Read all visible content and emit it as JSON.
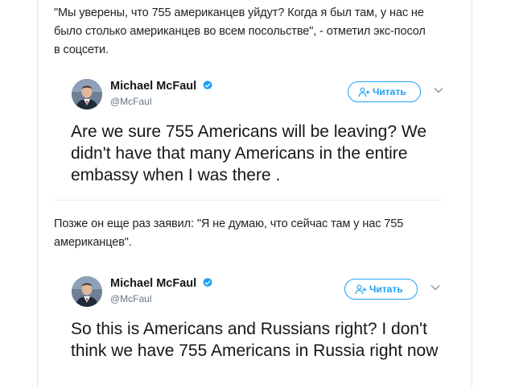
{
  "article": {
    "paragraph1": "\"Мы уверены, что 755 американцев уйдут? Когда я был там, у нас не было столько американцев во всем посольстве\", - отметил экс-посол в соцсети.",
    "paragraph2": "Позже он еще раз заявил: \"Я не думаю, что сейчас там у нас 755 американцев\"."
  },
  "tweets": [
    {
      "author_name": "Michael McFaul",
      "handle": "@McFaul",
      "follow_label": "Читать",
      "text": "Are we sure 755 Americans will be leaving? We didn't have that many Americans in the entire embassy when I was there ."
    },
    {
      "author_name": "Michael McFaul",
      "handle": "@McFaul",
      "follow_label": "Читать",
      "text": "So this is Americans and Russians right? I don't think we have 755 Americans in Russia right now"
    }
  ],
  "colors": {
    "accent": "#1da1f2",
    "text": "#14171a",
    "muted": "#657786"
  },
  "icons": {
    "verified": "verified-badge-icon",
    "follow": "follow-person-icon",
    "more": "chevron-down-icon"
  }
}
